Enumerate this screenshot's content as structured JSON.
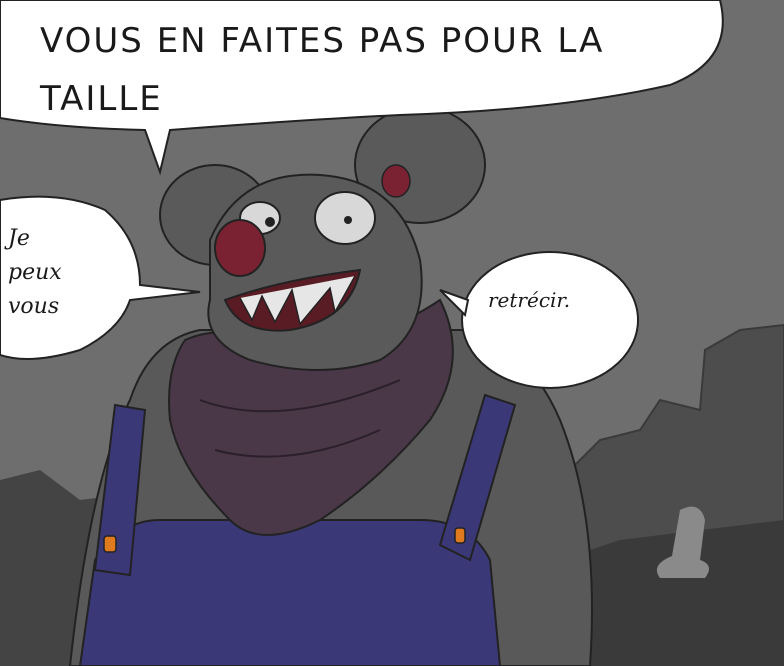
{
  "bubbles": {
    "top": "VOUS EN FAITES PAS    POUR LA\nTAILLE",
    "left": "Je\npeux\nvous",
    "right": "retrécir."
  },
  "colors": {
    "sky": "#6e6e6e",
    "ground": "#3f3f3f",
    "fur": "#5a5a5a",
    "nose": "#7a2232",
    "scarf": "#4a3848",
    "overalls": "#3b3878",
    "button": "#e07a1f"
  }
}
